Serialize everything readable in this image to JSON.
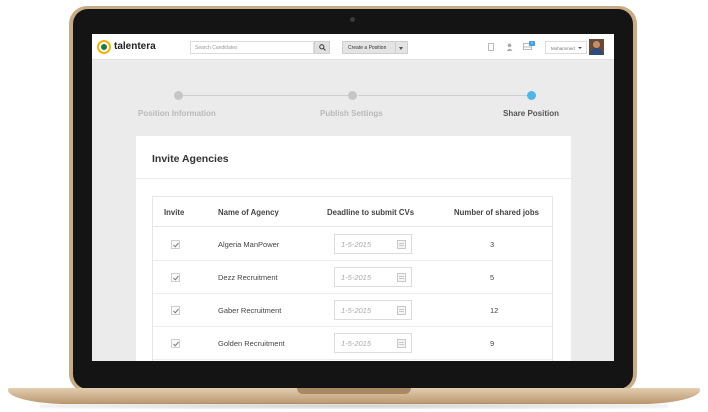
{
  "app": {
    "logo_text": "talentera"
  },
  "header": {
    "search_placeholder": "Search Candidates",
    "create_button": "Create a Position",
    "notification_count": "1",
    "user_name": "Mohammed"
  },
  "steps": [
    {
      "label": "Position Information",
      "state": "inactive"
    },
    {
      "label": "Publish Settings",
      "state": "inactive"
    },
    {
      "label": "Share Position",
      "state": "active"
    }
  ],
  "card": {
    "title": "Invite Agencies",
    "columns": [
      "Invite",
      "Name of Agency",
      "Deadline to submit CVs",
      "Number of shared jobs"
    ],
    "rows": [
      {
        "checked": true,
        "agency": "Algeria ManPower",
        "deadline": "1-5-2015",
        "jobs": "3"
      },
      {
        "checked": true,
        "agency": "Dezz Recruitment",
        "deadline": "1-5-2015",
        "jobs": "5"
      },
      {
        "checked": true,
        "agency": "Gaber Recruitment",
        "deadline": "1-5-2015",
        "jobs": "12"
      },
      {
        "checked": true,
        "agency": "Golden Recruitment",
        "deadline": "1-5-2015",
        "jobs": "9"
      }
    ]
  },
  "colors": {
    "active_step": "#4fb6ea",
    "inactive_step": "#c6c6c6",
    "laptop_gold": "#c9ab86",
    "logo_yellow": "#f2b400",
    "logo_green": "#1f7a3d"
  },
  "icons": [
    "search-icon",
    "document-icon",
    "user-icon",
    "inbox-icon",
    "chevron-down-icon",
    "check-icon",
    "calendar-icon"
  ]
}
